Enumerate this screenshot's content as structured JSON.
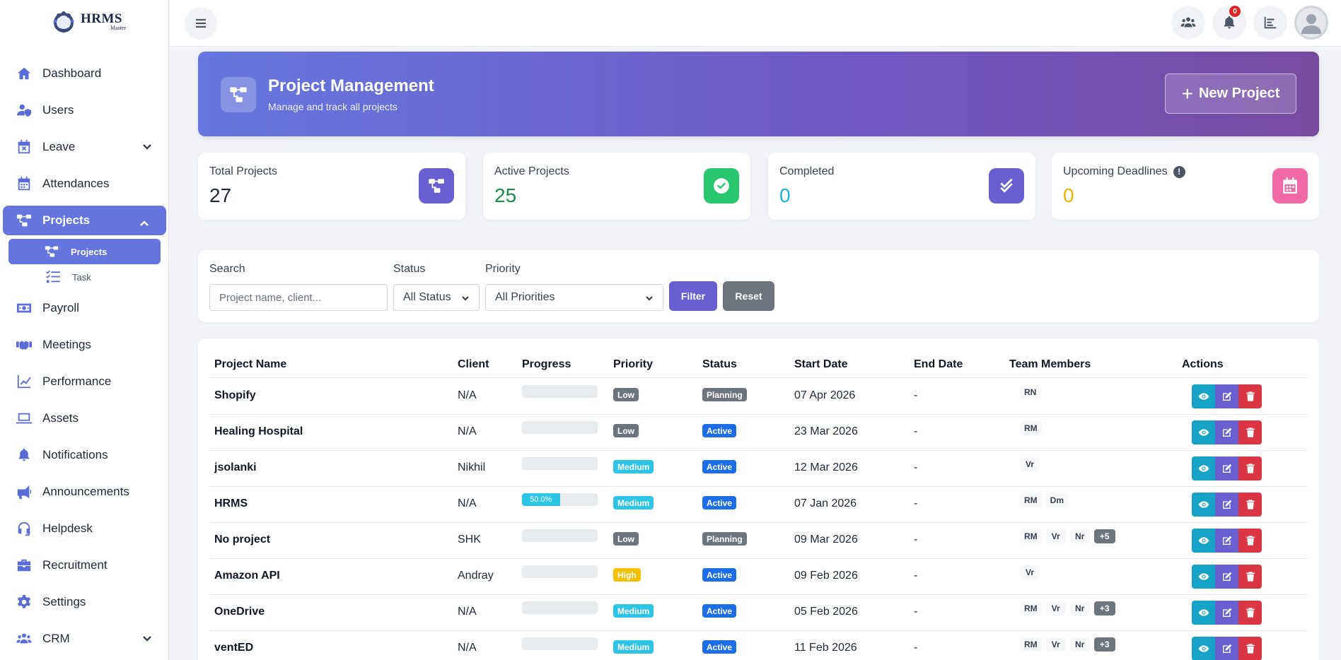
{
  "logo": {
    "line1": "HRMS",
    "line2": "Master"
  },
  "sidebar": {
    "items": [
      {
        "key": "dashboard",
        "label": "Dashboard",
        "icon": "home-icon"
      },
      {
        "key": "users",
        "label": "Users",
        "icon": "user-shield-icon"
      },
      {
        "key": "leave",
        "label": "Leave",
        "icon": "calendar-x-icon",
        "chevron": "down"
      },
      {
        "key": "attendances",
        "label": "Attendances",
        "icon": "calendar-icon"
      },
      {
        "key": "projects",
        "label": "Projects",
        "icon": "project-diagram-icon",
        "chevron": "up",
        "active": true
      },
      {
        "key": "payroll",
        "label": "Payroll",
        "icon": "money-icon"
      },
      {
        "key": "meetings",
        "label": "Meetings",
        "icon": "handshake-icon"
      },
      {
        "key": "performance",
        "label": "Performance",
        "icon": "chart-line-icon"
      },
      {
        "key": "assets",
        "label": "Assets",
        "icon": "laptop-icon"
      },
      {
        "key": "notifications",
        "label": "Notifications",
        "icon": "bell-icon"
      },
      {
        "key": "announcements",
        "label": "Announcements",
        "icon": "megaphone-icon"
      },
      {
        "key": "helpdesk",
        "label": "Helpdesk",
        "icon": "headset-icon"
      },
      {
        "key": "recruitment",
        "label": "Recruitment",
        "icon": "briefcase-icon"
      },
      {
        "key": "settings",
        "label": "Settings",
        "icon": "gear-icon"
      },
      {
        "key": "crm",
        "label": "CRM",
        "icon": "users-icon",
        "chevron": "down"
      }
    ],
    "sub_items": [
      {
        "label": "Projects",
        "icon": "project-diagram-icon",
        "active": true
      },
      {
        "label": "Task",
        "icon": "tasks-icon"
      }
    ]
  },
  "topbar": {
    "notification_count": "0"
  },
  "banner": {
    "title": "Project Management",
    "subtitle": "Manage and track all projects",
    "new_button": "New Project"
  },
  "stats": [
    {
      "label": "Total Projects",
      "value": "27",
      "color": "#1f2937",
      "icon_bg": "#6a5fd0"
    },
    {
      "label": "Active Projects",
      "value": "25",
      "color": "#1e8a4c",
      "icon_bg": "#28c76f"
    },
    {
      "label": "Completed",
      "value": "0",
      "color": "#17b3d8",
      "icon_bg": "#6a5fd0"
    },
    {
      "label": "Upcoming Deadlines",
      "value": "0",
      "color": "#f0b400",
      "icon_bg": "#f06aa8"
    }
  ],
  "filters": {
    "search_label": "Search",
    "search_placeholder": "Project name, client...",
    "status_label": "Status",
    "status_value": "All Status",
    "priority_label": "Priority",
    "priority_value": "All Priorities",
    "filter_button": "Filter",
    "reset_button": "Reset"
  },
  "table": {
    "headers": [
      "Project Name",
      "Client",
      "Progress",
      "Priority",
      "Status",
      "Start Date",
      "End Date",
      "Team Members",
      "Actions"
    ],
    "rows": [
      {
        "name": "Shopify",
        "client": "N/A",
        "progress": 0,
        "progress_label": "",
        "priority": "Low",
        "status": "Planning",
        "start": "07 Apr 2026",
        "end": "-",
        "members": [
          "RN"
        ]
      },
      {
        "name": "Healing Hospital",
        "client": "N/A",
        "progress": 0,
        "progress_label": "",
        "priority": "Low",
        "status": "Active",
        "start": "23 Mar 2026",
        "end": "-",
        "members": [
          "RM"
        ]
      },
      {
        "name": "jsolanki",
        "client": "Nikhil",
        "progress": 0,
        "progress_label": "",
        "priority": "Medium",
        "status": "Active",
        "start": "12 Mar 2026",
        "end": "-",
        "members": [
          "Vr"
        ]
      },
      {
        "name": "HRMS",
        "client": "N/A",
        "progress": 50,
        "progress_label": "50.0%",
        "priority": "Medium",
        "status": "Active",
        "start": "07 Jan 2026",
        "end": "-",
        "members": [
          "RM",
          "Dm"
        ]
      },
      {
        "name": "No project",
        "client": "SHK",
        "progress": 0,
        "progress_label": "",
        "priority": "Low",
        "status": "Planning",
        "start": "09 Mar 2026",
        "end": "-",
        "members": [
          "RM",
          "Vr",
          "Nr"
        ],
        "more": "+5"
      },
      {
        "name": "Amazon API",
        "client": "Andray",
        "progress": 0,
        "progress_label": "",
        "priority": "High",
        "status": "Active",
        "start": "09 Feb 2026",
        "end": "-",
        "members": [
          "Vr"
        ]
      },
      {
        "name": "OneDrive",
        "client": "N/A",
        "progress": 0,
        "progress_label": "",
        "priority": "Medium",
        "status": "Active",
        "start": "05 Feb 2026",
        "end": "-",
        "members": [
          "RM",
          "Vr",
          "Nr"
        ],
        "more": "+3"
      },
      {
        "name": "ventED",
        "client": "N/A",
        "progress": 0,
        "progress_label": "",
        "priority": "Medium",
        "status": "Active",
        "start": "11 Feb 2026",
        "end": "-",
        "members": [
          "RM",
          "Vr",
          "Nr"
        ],
        "more": "+3"
      }
    ]
  }
}
